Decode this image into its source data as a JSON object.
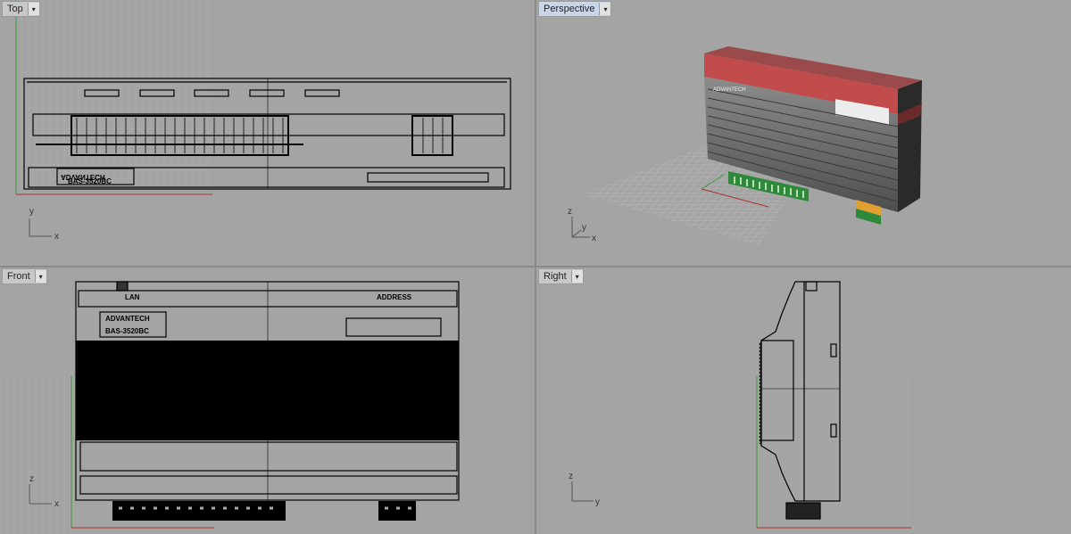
{
  "viewports": {
    "top": {
      "label": "Top",
      "dropdown": "▾"
    },
    "perspective": {
      "label": "Perspective",
      "dropdown": "▾"
    },
    "front": {
      "label": "Front",
      "dropdown": "▾"
    },
    "right": {
      "label": "Right",
      "dropdown": "▾"
    }
  },
  "axes": {
    "x": "x",
    "y": "y",
    "z": "z"
  },
  "model": {
    "brand": "ADVANTECH",
    "model_no": "BAS-3520BC",
    "port_lan": "LAN",
    "port_address": "ADDRESS"
  },
  "colors": {
    "viewport_bg": "#a4a4a4",
    "grid_line": "#b4b4b4",
    "x_axis": "#b03030",
    "y_axis": "#3a9a3a",
    "body_red": "#c24c4c",
    "terminal_green": "#2e8a3a"
  }
}
